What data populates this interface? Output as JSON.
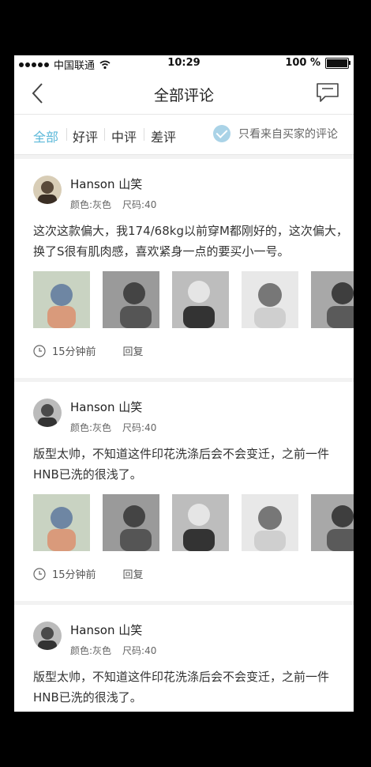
{
  "status_bar": {
    "carrier": "中国联通",
    "time": "10:29",
    "battery": "100 %",
    "battery_level": 1.0
  },
  "nav": {
    "title": "全部评论",
    "back_icon": "chevron-left-icon",
    "message_icon": "chat-bubble-icon"
  },
  "tabs": {
    "items": [
      {
        "label": "全部",
        "active": true
      },
      {
        "label": "好评",
        "active": false
      },
      {
        "label": "中评",
        "active": false
      },
      {
        "label": "差评",
        "active": false
      }
    ],
    "only_buyers_label": "只看来自买家的评论",
    "only_buyers_checked": true
  },
  "reviews": [
    {
      "user": "Hanson 山笑",
      "color": "颜色:灰色",
      "size": "尺码:40",
      "text": "这次这款偏大，我174/68kg以前穿M都刚好的，这次偏大，换了S很有肌肉感，喜欢紧身一点的要买小一号。",
      "time": "15分钟前",
      "reply": "回复"
    },
    {
      "user": "Hanson 山笑",
      "color": "颜色:灰色",
      "size": "尺码:40",
      "text": "版型太帅，不知道这件印花洗涤后会不会变迁，之前一件HNB已洗的很浅了。",
      "time": "15分钟前",
      "reply": "回复"
    },
    {
      "user": "Hanson 山笑",
      "color": "颜色:灰色",
      "size": "尺码:40",
      "text": "版型太帅，不知道这件印花洗涤后会不会变迁，之前一件HNB已洗的很浅了。"
    }
  ],
  "colors": {
    "accent": "#5bb8d9",
    "check": "#aad3e7",
    "text": "#333333"
  }
}
